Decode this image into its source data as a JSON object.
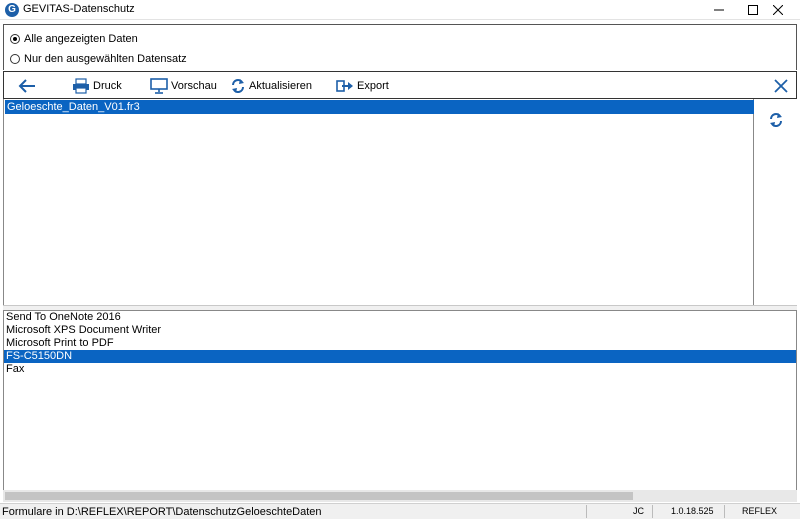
{
  "window": {
    "title": "GEVITAS-Datenschutz",
    "icon_letter": "G",
    "icons": [
      "minimize-icon",
      "maximize-icon",
      "close-icon"
    ]
  },
  "options": {
    "radio_all": {
      "label": "Alle angezeigten Daten",
      "checked": true
    },
    "radio_selected": {
      "label": "Nur den ausgewählten Datensatz",
      "checked": false
    }
  },
  "toolbar": {
    "back_icon": "arrow-left-icon",
    "print_label": "Druck",
    "preview_label": "Vorschau",
    "refresh_label": "Aktualisieren",
    "export_label": "Export",
    "close_icon": "close-icon"
  },
  "reports": {
    "items": [
      "Geloeschte_Daten_V01.fr3"
    ],
    "selected": "Geloeschte_Daten_V01.fr3"
  },
  "printers": {
    "items": [
      "Send To OneNote 2016",
      "Microsoft XPS Document Writer",
      "Microsoft Print to PDF",
      "FS-C5150DN",
      "Fax"
    ],
    "selected": "FS-C5150DN"
  },
  "statusbar": {
    "path": "Formulare in D:\\REFLEX\\REPORT\\DatenschutzGeloeschteDaten",
    "user": "JC",
    "version": "1.0.18.525",
    "product": "REFLEX"
  },
  "colors": {
    "selection": "#0a64c2",
    "icon_blue": "#1d5fa8"
  }
}
